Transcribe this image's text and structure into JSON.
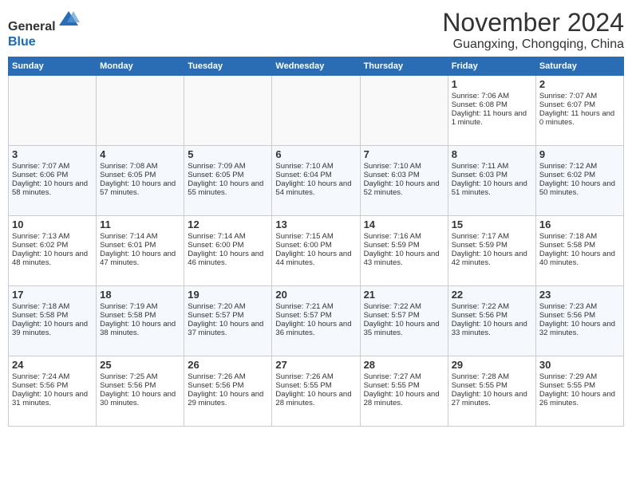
{
  "header": {
    "logo_line1": "General",
    "logo_line2": "Blue",
    "month_title": "November 2024",
    "location": "Guangxing, Chongqing, China"
  },
  "days_of_week": [
    "Sunday",
    "Monday",
    "Tuesday",
    "Wednesday",
    "Thursday",
    "Friday",
    "Saturday"
  ],
  "weeks": [
    [
      {
        "day": "",
        "empty": true
      },
      {
        "day": "",
        "empty": true
      },
      {
        "day": "",
        "empty": true
      },
      {
        "day": "",
        "empty": true
      },
      {
        "day": "",
        "empty": true
      },
      {
        "day": "1",
        "sunrise": "7:06 AM",
        "sunset": "6:08 PM",
        "daylight": "11 hours and 1 minute."
      },
      {
        "day": "2",
        "sunrise": "7:07 AM",
        "sunset": "6:07 PM",
        "daylight": "11 hours and 0 minutes."
      }
    ],
    [
      {
        "day": "3",
        "sunrise": "7:07 AM",
        "sunset": "6:06 PM",
        "daylight": "10 hours and 58 minutes."
      },
      {
        "day": "4",
        "sunrise": "7:08 AM",
        "sunset": "6:05 PM",
        "daylight": "10 hours and 57 minutes."
      },
      {
        "day": "5",
        "sunrise": "7:09 AM",
        "sunset": "6:05 PM",
        "daylight": "10 hours and 55 minutes."
      },
      {
        "day": "6",
        "sunrise": "7:10 AM",
        "sunset": "6:04 PM",
        "daylight": "10 hours and 54 minutes."
      },
      {
        "day": "7",
        "sunrise": "7:10 AM",
        "sunset": "6:03 PM",
        "daylight": "10 hours and 52 minutes."
      },
      {
        "day": "8",
        "sunrise": "7:11 AM",
        "sunset": "6:03 PM",
        "daylight": "10 hours and 51 minutes."
      },
      {
        "day": "9",
        "sunrise": "7:12 AM",
        "sunset": "6:02 PM",
        "daylight": "10 hours and 50 minutes."
      }
    ],
    [
      {
        "day": "10",
        "sunrise": "7:13 AM",
        "sunset": "6:02 PM",
        "daylight": "10 hours and 48 minutes."
      },
      {
        "day": "11",
        "sunrise": "7:14 AM",
        "sunset": "6:01 PM",
        "daylight": "10 hours and 47 minutes."
      },
      {
        "day": "12",
        "sunrise": "7:14 AM",
        "sunset": "6:00 PM",
        "daylight": "10 hours and 46 minutes."
      },
      {
        "day": "13",
        "sunrise": "7:15 AM",
        "sunset": "6:00 PM",
        "daylight": "10 hours and 44 minutes."
      },
      {
        "day": "14",
        "sunrise": "7:16 AM",
        "sunset": "5:59 PM",
        "daylight": "10 hours and 43 minutes."
      },
      {
        "day": "15",
        "sunrise": "7:17 AM",
        "sunset": "5:59 PM",
        "daylight": "10 hours and 42 minutes."
      },
      {
        "day": "16",
        "sunrise": "7:18 AM",
        "sunset": "5:58 PM",
        "daylight": "10 hours and 40 minutes."
      }
    ],
    [
      {
        "day": "17",
        "sunrise": "7:18 AM",
        "sunset": "5:58 PM",
        "daylight": "10 hours and 39 minutes."
      },
      {
        "day": "18",
        "sunrise": "7:19 AM",
        "sunset": "5:58 PM",
        "daylight": "10 hours and 38 minutes."
      },
      {
        "day": "19",
        "sunrise": "7:20 AM",
        "sunset": "5:57 PM",
        "daylight": "10 hours and 37 minutes."
      },
      {
        "day": "20",
        "sunrise": "7:21 AM",
        "sunset": "5:57 PM",
        "daylight": "10 hours and 36 minutes."
      },
      {
        "day": "21",
        "sunrise": "7:22 AM",
        "sunset": "5:57 PM",
        "daylight": "10 hours and 35 minutes."
      },
      {
        "day": "22",
        "sunrise": "7:22 AM",
        "sunset": "5:56 PM",
        "daylight": "10 hours and 33 minutes."
      },
      {
        "day": "23",
        "sunrise": "7:23 AM",
        "sunset": "5:56 PM",
        "daylight": "10 hours and 32 minutes."
      }
    ],
    [
      {
        "day": "24",
        "sunrise": "7:24 AM",
        "sunset": "5:56 PM",
        "daylight": "10 hours and 31 minutes."
      },
      {
        "day": "25",
        "sunrise": "7:25 AM",
        "sunset": "5:56 PM",
        "daylight": "10 hours and 30 minutes."
      },
      {
        "day": "26",
        "sunrise": "7:26 AM",
        "sunset": "5:56 PM",
        "daylight": "10 hours and 29 minutes."
      },
      {
        "day": "27",
        "sunrise": "7:26 AM",
        "sunset": "5:55 PM",
        "daylight": "10 hours and 28 minutes."
      },
      {
        "day": "28",
        "sunrise": "7:27 AM",
        "sunset": "5:55 PM",
        "daylight": "10 hours and 28 minutes."
      },
      {
        "day": "29",
        "sunrise": "7:28 AM",
        "sunset": "5:55 PM",
        "daylight": "10 hours and 27 minutes."
      },
      {
        "day": "30",
        "sunrise": "7:29 AM",
        "sunset": "5:55 PM",
        "daylight": "10 hours and 26 minutes."
      }
    ]
  ]
}
